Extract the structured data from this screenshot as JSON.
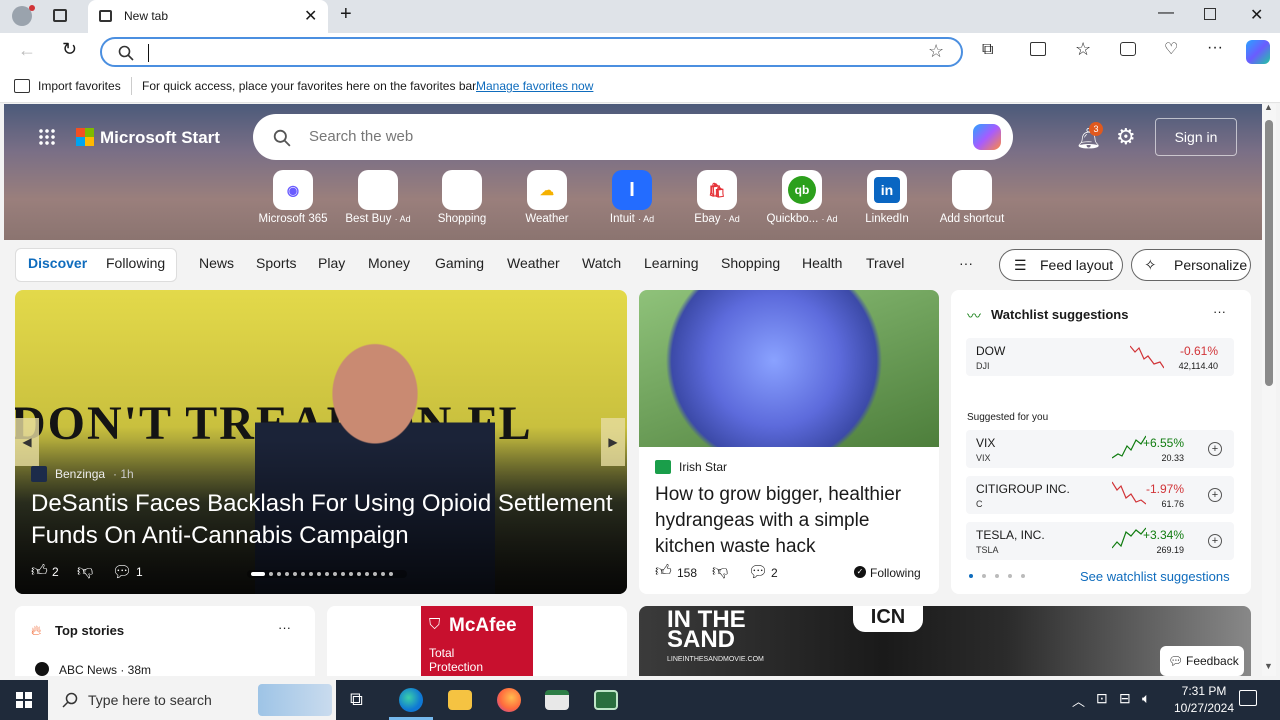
{
  "browser": {
    "tab_title": "New tab",
    "address_value": "",
    "import_favorites": "Import favorites",
    "favbar_hint": "For quick access, place your favorites here on the favorites bar.",
    "manage_favorites": "Manage favorites now"
  },
  "header": {
    "brand": "Microsoft Start",
    "search_placeholder": "Search the web",
    "notif_count": "3",
    "sign_in": "Sign in"
  },
  "shortcuts": [
    {
      "label": "Microsoft 365",
      "ad": ""
    },
    {
      "label": "Best Buy",
      "ad": "· Ad"
    },
    {
      "label": "Shopping",
      "ad": ""
    },
    {
      "label": "Weather",
      "ad": ""
    },
    {
      "label": "Intuit",
      "ad": "· Ad"
    },
    {
      "label": "Ebay",
      "ad": "· Ad"
    },
    {
      "label": "Quickbo...",
      "ad": "· Ad"
    },
    {
      "label": "LinkedIn",
      "ad": ""
    },
    {
      "label": "Add shortcut",
      "ad": ""
    }
  ],
  "categories": {
    "discover": "Discover",
    "following": "Following",
    "items": [
      "News",
      "Sports",
      "Play",
      "Money",
      "Gaming",
      "Weather",
      "Watch",
      "Learning",
      "Shopping",
      "Health",
      "Travel"
    ],
    "more": "···",
    "feed_layout": "Feed layout",
    "personalize": "Personalize"
  },
  "main_story": {
    "source": "Benzinga",
    "age": "· 1h",
    "headline": "DeSantis Faces Backlash For Using Opioid Settlement Funds On Anti-Cannabis Campaign",
    "likes": "2",
    "comments": "1",
    "image_text": "DON'T TREAD ON FL"
  },
  "side_story": {
    "source": "Irish Star",
    "headline": "How to grow bigger, healthier hydrangeas with a simple kitchen waste hack",
    "likes": "158",
    "comments": "2",
    "following": "Following"
  },
  "watchlist": {
    "title": "Watchlist suggestions",
    "top": {
      "name": "DOW",
      "symbol": "DJI",
      "change": "-0.61%",
      "value": "42,114.40"
    },
    "suggested_label": "Suggested for you",
    "items": [
      {
        "name": "VIX",
        "symbol": "VIX",
        "change": "+6.55%",
        "value": "20.33"
      },
      {
        "name": "CITIGROUP INC.",
        "symbol": "C",
        "change": "-1.97%",
        "value": "61.76"
      },
      {
        "name": "TESLA, INC.",
        "symbol": "TSLA",
        "change": "+3.34%",
        "value": "269.19"
      }
    ],
    "see_more": "See watchlist suggestions"
  },
  "bottom": {
    "top_stories": "Top stories",
    "abc": "ABC News · 38m",
    "mcafee": "McAfee",
    "mcafee_sub": "Total Protection",
    "sand": "IN THE SAND",
    "sand_url": "LINEINTHESANDMOVIE.COM",
    "icn": "ICN",
    "feedback": "Feedback"
  },
  "taskbar": {
    "search_placeholder": "Type here to search",
    "time": "7:31 PM",
    "date": "10/27/2024"
  },
  "colors": {
    "accent": "#0f6cbd",
    "neg": "#d13438",
    "pos": "#107c10",
    "taskbar": "#1f2a3a"
  }
}
